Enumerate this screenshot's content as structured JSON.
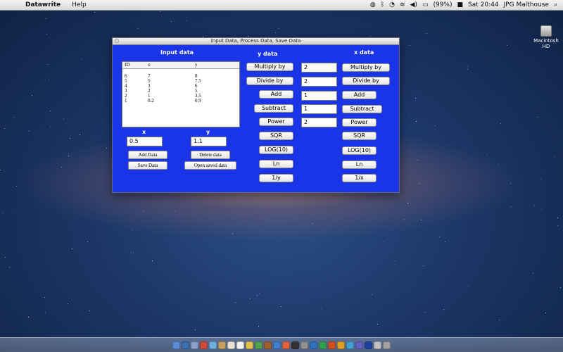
{
  "menubar": {
    "app_name": "Datawrite",
    "menu_help": "Help",
    "battery": "(99%)",
    "clock": "Sat 20:44",
    "user": "JPG Malthouse"
  },
  "desktop": {
    "disk_label": "Macintosh HD"
  },
  "window": {
    "title": "Input Data, Process Data, Save Data",
    "input_heading": "Input data",
    "table": {
      "headers": [
        "ID",
        "x",
        "y"
      ],
      "rows": [
        [
          "6",
          "7",
          "8"
        ],
        [
          "5",
          "5",
          "7.5"
        ],
        [
          "4",
          "3",
          "6"
        ],
        [
          "3",
          "2",
          "5"
        ],
        [
          "2",
          "1",
          "3.5"
        ],
        [
          "1",
          "0.2",
          "0.9"
        ]
      ]
    },
    "x_label": "x",
    "y_label": "y",
    "x_value": "0.5",
    "y_value": "1.1",
    "add_data": "Add Data",
    "delete_data": "Delete data",
    "save_data": "Save Data",
    "open_saved": "Open saved data",
    "y_heading": "y data",
    "x_heading": "x data",
    "y_ops": [
      "Multiply by",
      "Divide by",
      "Add",
      "Subtract",
      "Power",
      "SQR",
      "LOG(10)",
      "Ln",
      "1/y"
    ],
    "x_ops": [
      "Multiply by",
      "Divide by",
      "Add",
      "Subtract",
      "Power",
      "SQR",
      "LOG(10)",
      "Ln",
      "1/x"
    ],
    "operands": [
      "2",
      "2",
      "1",
      "1",
      "2"
    ]
  }
}
